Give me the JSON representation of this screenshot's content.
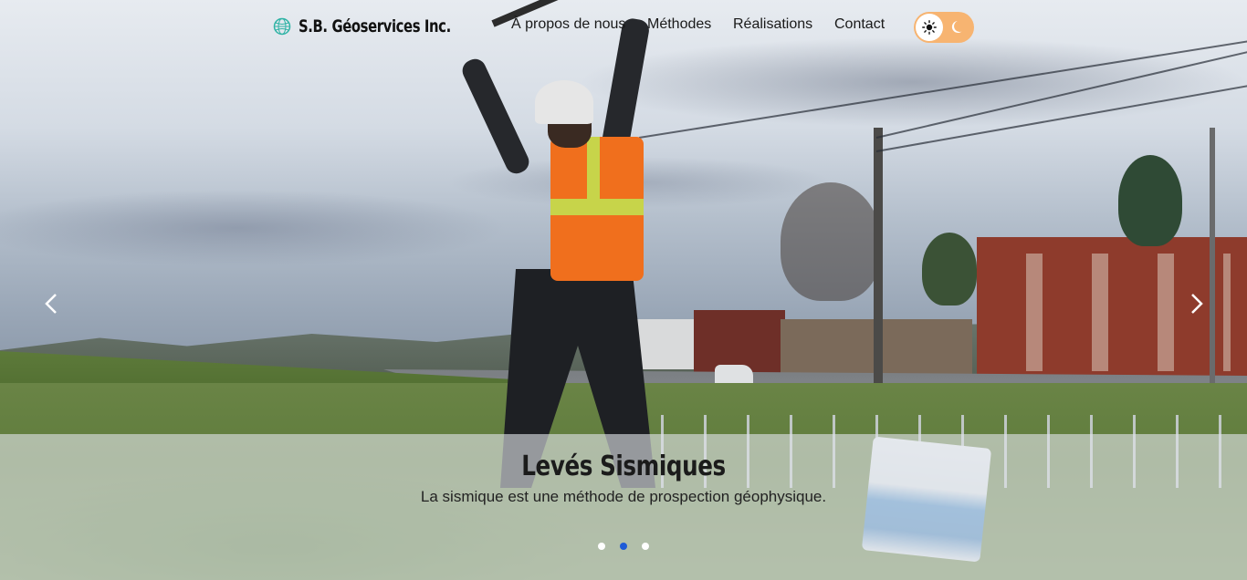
{
  "header": {
    "logo_text": "S.B. Géoservices Inc.",
    "logo_icon": "globe-mesh-icon",
    "nav": [
      {
        "label": "À propos de nous"
      },
      {
        "label": "Méthodes"
      },
      {
        "label": "Réalisations"
      },
      {
        "label": "Contact"
      }
    ],
    "theme_toggle": {
      "light_icon": "sun-icon",
      "dark_icon": "moon-icon",
      "selected": "light"
    }
  },
  "carousel": {
    "title": "Levés Sismiques",
    "description": "La sismique est une méthode de prospection géophysique.",
    "prev_icon": "chevron-left-icon",
    "next_icon": "chevron-right-icon",
    "slides_count": 3,
    "active_slide": 2
  },
  "colors": {
    "accent": "#1f5bd7",
    "toggle": "#f7b471",
    "logo": "#2fb3a5"
  }
}
